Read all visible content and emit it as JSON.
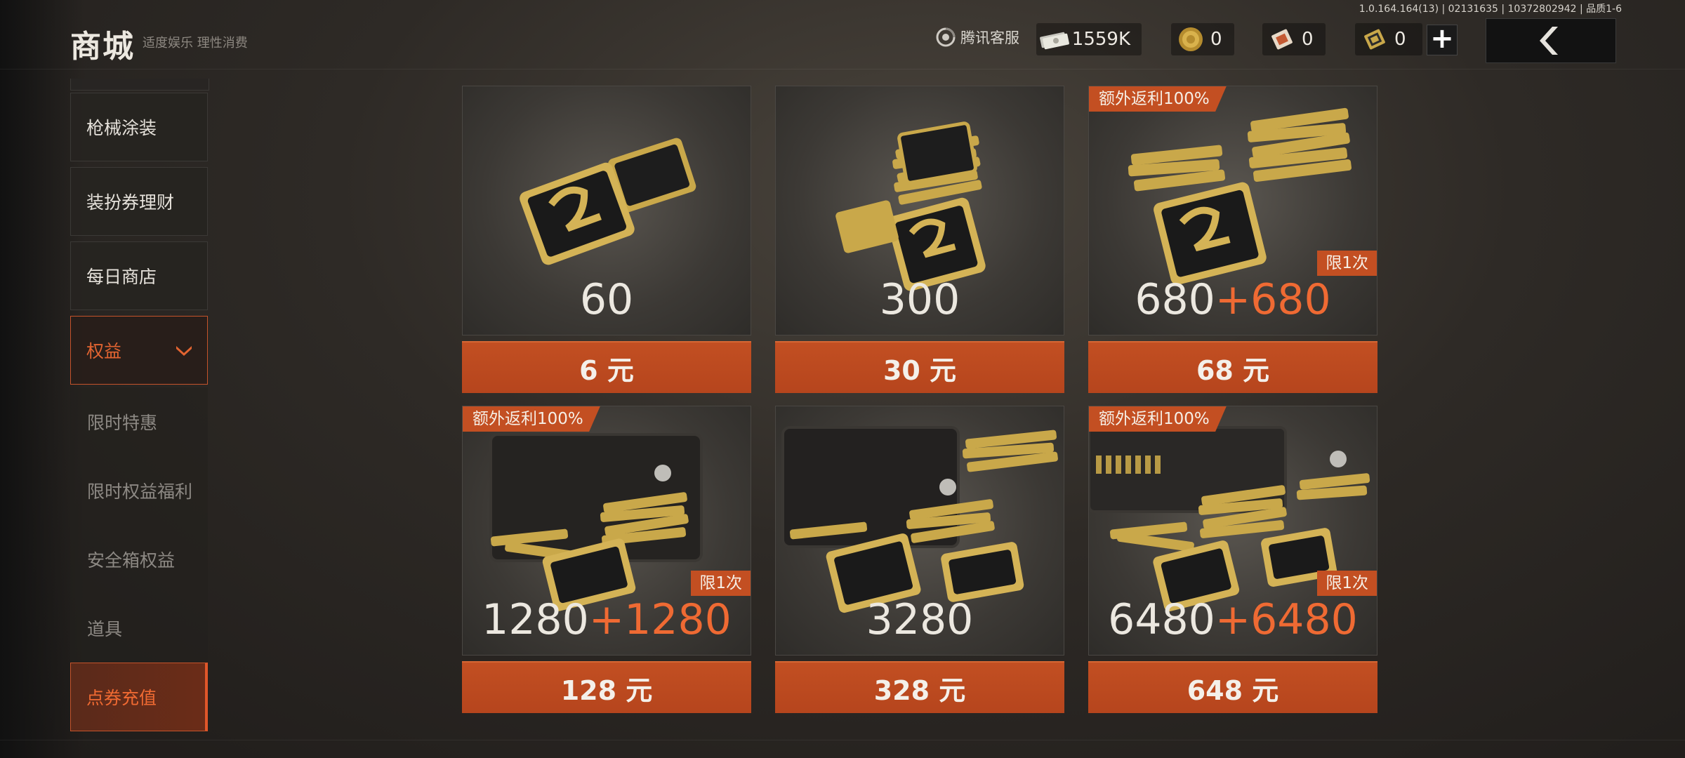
{
  "header": {
    "title": "商城",
    "subtitle": "适度娱乐 理性消费",
    "version": "1.0.164.164(13) | 02131635 | 10372802942 | 品质1-6",
    "support_label": "腾讯客服"
  },
  "currencies": [
    {
      "icon": "cash-icon",
      "value": "1559K"
    },
    {
      "icon": "gold-coin-icon",
      "value": "0"
    },
    {
      "icon": "ticket-icon",
      "value": "0"
    },
    {
      "icon": "voucher-icon",
      "value": "0"
    }
  ],
  "sidebar": {
    "items": [
      {
        "label": "枪械涂装"
      },
      {
        "label": "装扮券理财"
      },
      {
        "label": "每日商店"
      },
      {
        "label": "权益"
      },
      {
        "label": "限时特惠"
      },
      {
        "label": "限时权益福利"
      },
      {
        "label": "安全箱权益"
      },
      {
        "label": "道具"
      },
      {
        "label": "点券充值"
      }
    ]
  },
  "products": [
    {
      "amount": "60",
      "bonus": "",
      "price": "6 元",
      "bonus_badge": "",
      "limit_badge": ""
    },
    {
      "amount": "300",
      "bonus": "",
      "price": "30 元",
      "bonus_badge": "",
      "limit_badge": ""
    },
    {
      "amount": "680",
      "bonus": "+680",
      "price": "68 元",
      "bonus_badge": "额外返利100%",
      "limit_badge": "限1次"
    },
    {
      "amount": "1280",
      "bonus": "+1280",
      "price": "128 元",
      "bonus_badge": "额外返利100%",
      "limit_badge": "限1次"
    },
    {
      "amount": "3280",
      "bonus": "",
      "price": "328 元",
      "bonus_badge": "",
      "limit_badge": ""
    },
    {
      "amount": "6480",
      "bonus": "+6480",
      "price": "648 元",
      "bonus_badge": "额外返利100%",
      "limit_badge": "限1次"
    }
  ],
  "colors": {
    "accent": "#c34f22",
    "accent_text": "#ef6a33",
    "background": "#2e2a26"
  }
}
